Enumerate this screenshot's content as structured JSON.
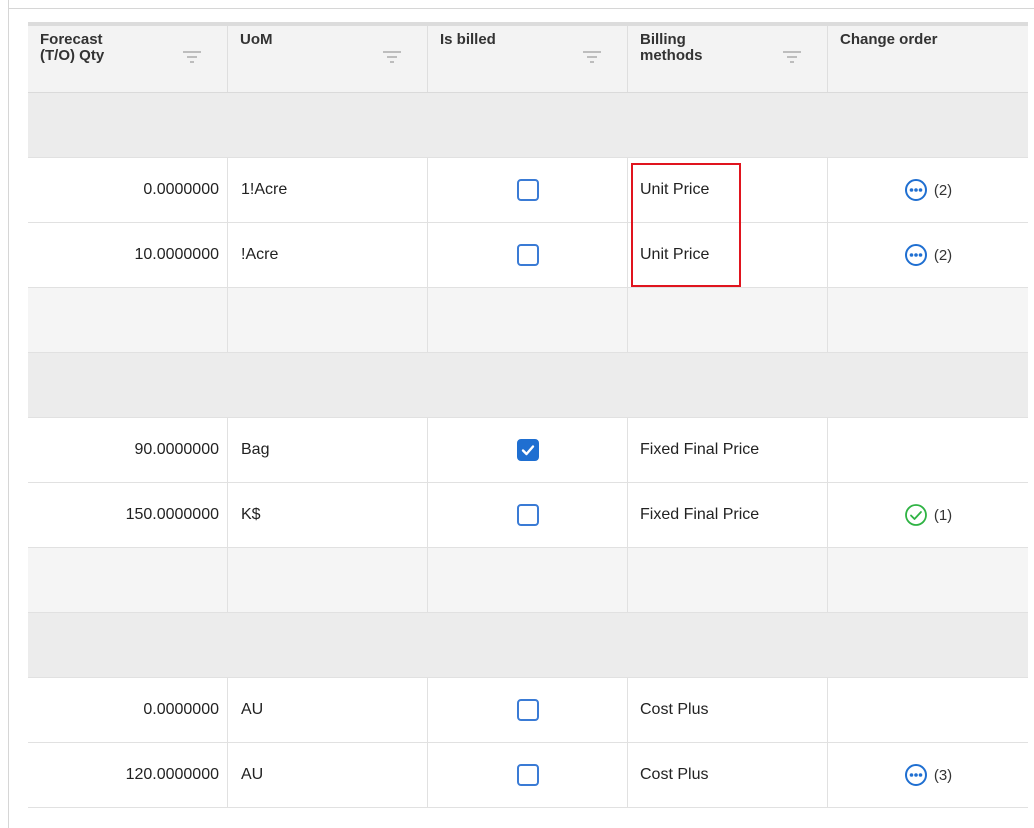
{
  "columns": [
    {
      "label_line1": "Forecast",
      "label_line2": "(T/O) Qty",
      "has_filter": true
    },
    {
      "label_line1": "UoM",
      "label_line2": "",
      "has_filter": true
    },
    {
      "label_line1": "Is billed",
      "label_line2": "",
      "has_filter": true
    },
    {
      "label_line1": "Billing",
      "label_line2": "methods",
      "has_filter": true
    },
    {
      "label_line1": "Change order",
      "label_line2": "",
      "has_filter": false
    }
  ],
  "rows": [
    {
      "type": "group"
    },
    {
      "type": "data",
      "qty": "0.0000000",
      "uom": "1!Acre",
      "billed": false,
      "billing": "Unit Price",
      "co_icon": "more-circle-icon",
      "co_count": "(2)"
    },
    {
      "type": "data",
      "qty": "10.0000000",
      "uom": "!Acre",
      "billed": false,
      "billing": "Unit Price",
      "co_icon": "more-circle-icon",
      "co_count": "(2)"
    },
    {
      "type": "sub"
    },
    {
      "type": "group"
    },
    {
      "type": "data",
      "qty": "90.0000000",
      "uom": "Bag",
      "billed": true,
      "billing": "Fixed Final Price",
      "co_icon": "",
      "co_count": ""
    },
    {
      "type": "data",
      "qty": "150.0000000",
      "uom": "K$",
      "billed": false,
      "billing": "Fixed Final Price",
      "co_icon": "check-circle-icon",
      "co_count": "(1)"
    },
    {
      "type": "sub"
    },
    {
      "type": "group"
    },
    {
      "type": "data",
      "qty": "0.0000000",
      "uom": "AU",
      "billed": false,
      "billing": "Cost Plus",
      "co_icon": "",
      "co_count": ""
    },
    {
      "type": "data",
      "qty": "120.0000000",
      "uom": "AU",
      "billed": false,
      "billing": "Cost Plus",
      "co_icon": "more-circle-icon",
      "co_count": "(3)"
    }
  ],
  "colors": {
    "accent_blue": "#1f6fd1",
    "checkbox_border": "#3a7bd5",
    "success_green": "#2fb344",
    "highlight_red": "#e0141e"
  }
}
